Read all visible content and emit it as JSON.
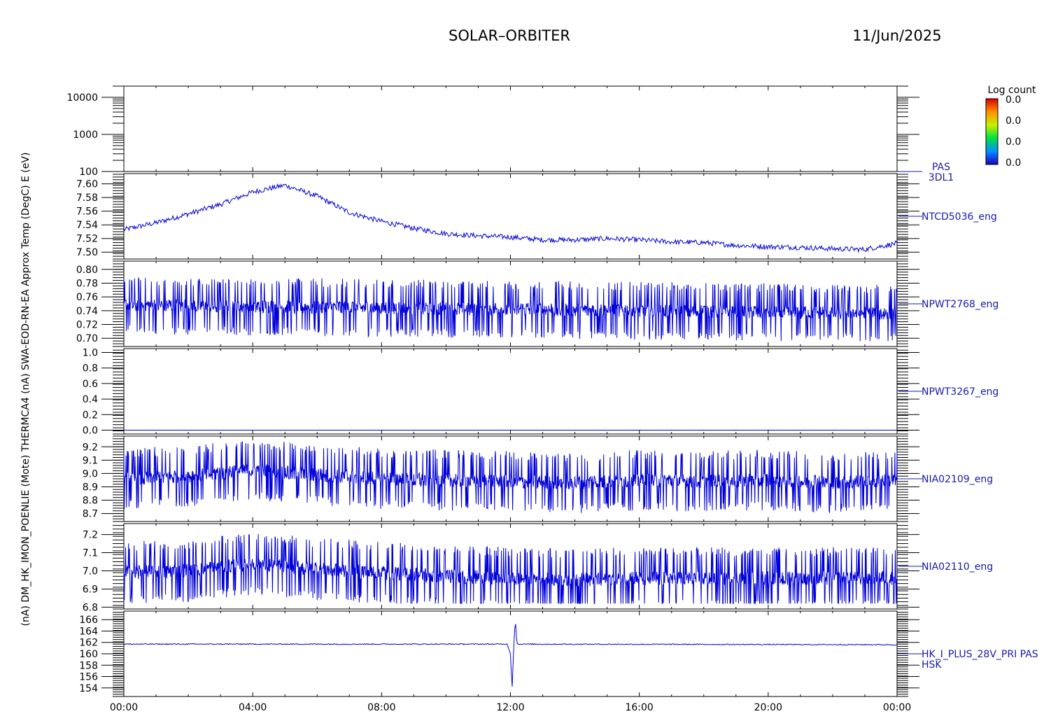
{
  "header": {
    "mission": "SOLAR–ORBITER",
    "date": "11/Jun/2025"
  },
  "colorbar": {
    "title": "Log count",
    "labels": [
      "0.0",
      "0.0",
      "0.0",
      "0.0"
    ]
  },
  "x_tick_labels": [
    "00:00",
    "04:00",
    "08:00",
    "12:00",
    "16:00",
    "20:00",
    "00:00"
  ],
  "y_axis_title_overlap": "(nA) DM_HK_IMON_POENLIE (Mote) THERMCA4 (nA) SWA-EOD-RN-EA Approx Temp (DegC) E (eV)",
  "chart_data": [
    {
      "type": "heatmap",
      "name": "PAS 3DL1",
      "right_label_lines": [
        "PAS",
        "3DL1"
      ],
      "y_scale": "log",
      "ylim": [
        100,
        20000
      ],
      "y_ticks": [
        100,
        1000,
        10000
      ],
      "y_tick_labels": [
        "100",
        "1000",
        "10000"
      ],
      "values": []
    },
    {
      "type": "line",
      "name": "NTCD5036_eng",
      "right_label_lines": [
        "NTCD5036_eng"
      ],
      "ylim": [
        7.49,
        7.615
      ],
      "y_ticks": [
        7.5,
        7.52,
        7.54,
        7.56,
        7.58,
        7.6
      ],
      "y_tick_labels": [
        "7.50",
        "7.52",
        "7.54",
        "7.56",
        "7.58",
        "7.60"
      ],
      "x": [
        0,
        1,
        2,
        3,
        4,
        5,
        6,
        7,
        8,
        9,
        10,
        11,
        12,
        13,
        14,
        15,
        16,
        17,
        18,
        19,
        20,
        21,
        22,
        23,
        24
      ],
      "y": [
        7.533,
        7.543,
        7.556,
        7.57,
        7.588,
        7.598,
        7.582,
        7.558,
        7.545,
        7.535,
        7.527,
        7.524,
        7.522,
        7.518,
        7.518,
        7.52,
        7.518,
        7.515,
        7.514,
        7.51,
        7.508,
        7.507,
        7.505,
        7.504,
        7.513
      ]
    },
    {
      "type": "line",
      "name": "NPWT2768_eng",
      "right_label_lines": [
        "NPWT2768_eng"
      ],
      "ylim": [
        0.688,
        0.812
      ],
      "y_ticks": [
        0.7,
        0.72,
        0.74,
        0.76,
        0.78,
        0.8
      ],
      "y_tick_labels": [
        "0.70",
        "0.72",
        "0.74",
        "0.76",
        "0.78",
        "0.80"
      ],
      "x": [
        0,
        4,
        8,
        12,
        16,
        20,
        24
      ],
      "y": [
        0.748,
        0.746,
        0.744,
        0.742,
        0.74,
        0.738,
        0.736
      ],
      "noise_range": [
        0.695,
        0.8
      ]
    },
    {
      "type": "line",
      "name": "NPWT3267_eng",
      "right_label_lines": [
        "NPWT3267_eng"
      ],
      "ylim": [
        -0.05,
        1.05
      ],
      "y_ticks": [
        0.0,
        0.2,
        0.4,
        0.6,
        0.8,
        1.0
      ],
      "y_tick_labels": [
        "0.0",
        "0.2",
        "0.4",
        "0.6",
        "0.8",
        "1.0"
      ],
      "x": [
        0,
        24
      ],
      "y": [
        0.0,
        0.0
      ]
    },
    {
      "type": "line",
      "name": "NIA02109_eng",
      "right_label_lines": [
        "NIA02109_eng"
      ],
      "ylim": [
        8.64,
        9.28
      ],
      "y_ticks": [
        8.7,
        8.8,
        8.9,
        9.0,
        9.1,
        9.2
      ],
      "y_tick_labels": [
        "8.7",
        "8.8",
        "8.9",
        "9.0",
        "9.1",
        "9.2"
      ],
      "x": [
        0,
        2,
        4,
        6,
        8,
        10,
        12,
        14,
        16,
        18,
        20,
        22,
        24
      ],
      "y": [
        8.96,
        8.98,
        9.03,
        8.99,
        8.96,
        8.95,
        8.94,
        8.93,
        8.95,
        8.94,
        8.95,
        8.93,
        8.95
      ],
      "noise_range": [
        8.67,
        9.24
      ]
    },
    {
      "type": "line",
      "name": "NIA02110_eng",
      "right_label_lines": [
        "NIA02110_eng"
      ],
      "ylim": [
        6.79,
        7.26
      ],
      "y_ticks": [
        6.8,
        6.9,
        7.0,
        7.1,
        7.2
      ],
      "y_tick_labels": [
        "6.8",
        "6.9",
        "7.0",
        "7.1",
        "7.2"
      ],
      "x": [
        0,
        2,
        4,
        6,
        8,
        10,
        12,
        14,
        16,
        18,
        20,
        22,
        24
      ],
      "y": [
        6.99,
        7.0,
        7.04,
        7.01,
        6.99,
        6.97,
        6.96,
        6.95,
        6.96,
        6.96,
        6.96,
        6.96,
        6.96
      ],
      "noise_range": [
        6.82,
        7.25
      ]
    },
    {
      "type": "line",
      "name": "HK_I_PLUS_28V_PRI PAS HSK",
      "right_label_lines": [
        "HK_I_PLUS_28V_PRI PAS",
        "HSK"
      ],
      "ylim": [
        152.5,
        167.5
      ],
      "y_ticks": [
        154,
        156,
        158,
        160,
        162,
        164,
        166
      ],
      "y_tick_labels": [
        "154",
        "156",
        "158",
        "160",
        "162",
        "164",
        "166"
      ],
      "x": [
        0,
        11.9,
        12.0,
        12.05,
        12.1,
        12.15,
        12.2,
        24
      ],
      "y": [
        161.7,
        161.7,
        160.0,
        153.8,
        161.0,
        166.2,
        161.7,
        161.6
      ]
    }
  ]
}
